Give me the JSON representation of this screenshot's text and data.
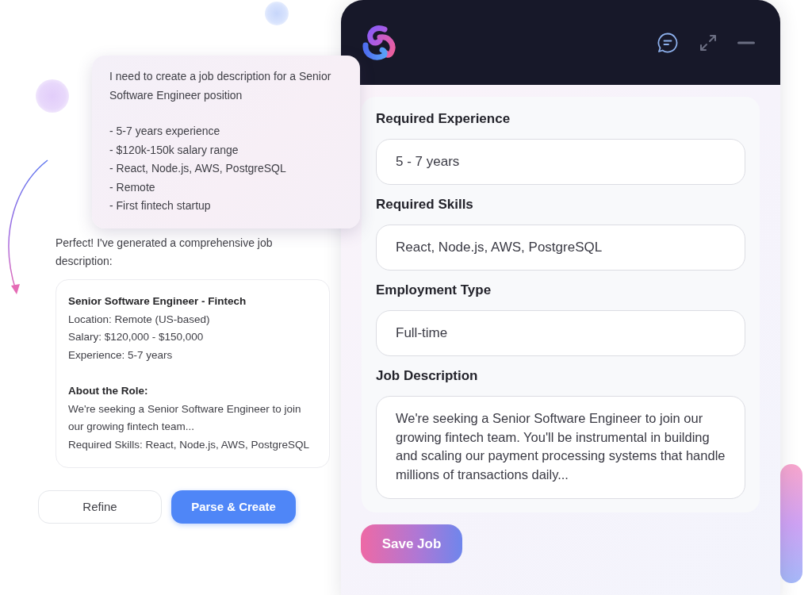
{
  "chat": {
    "user_message": {
      "text": "I need to create a job description for a Senior Software Engineer position",
      "items": [
        "- 5-7 years experience",
        "- $120k-150k salary range",
        "- React, Node.js, AWS, PostgreSQL",
        "- Remote",
        "- First fintech startup"
      ]
    },
    "assistant_message": "Perfect! I've generated a comprehensive job description:",
    "generated_card": {
      "title": "Senior Software Engineer - Fintech",
      "details": [
        "Location: Remote (US-based)",
        "Salary: $120,000 - $150,000",
        "Experience: 5-7 years"
      ],
      "section_heading": "About the Role:",
      "section_lines": [
        "We're seeking a Senior Software Engineer to join our growing fintech team...",
        "Required Skills: React, Node.js, AWS, PostgreSQL"
      ]
    },
    "buttons": [
      {
        "label": "Refine",
        "kind": "secondary"
      },
      {
        "label": "Parse & Create",
        "kind": "primary"
      }
    ]
  },
  "app_window": {
    "form": {
      "fields": [
        {
          "label": "Required Experience",
          "value": "5 - 7 years",
          "kind": "input"
        },
        {
          "label": "Required Skills",
          "value": "React, Node.js, AWS, PostgreSQL",
          "kind": "input"
        },
        {
          "label": "Employment Type",
          "value": "Full-time",
          "kind": "input"
        },
        {
          "label": "Job Description",
          "value": "We're seeking a Senior Software Engineer to join our growing fintech team. You'll be instrumental in building and scaling our payment processing systems that handle millions of transactions daily...",
          "kind": "textarea"
        }
      ]
    },
    "save_button": "Save Job"
  }
}
